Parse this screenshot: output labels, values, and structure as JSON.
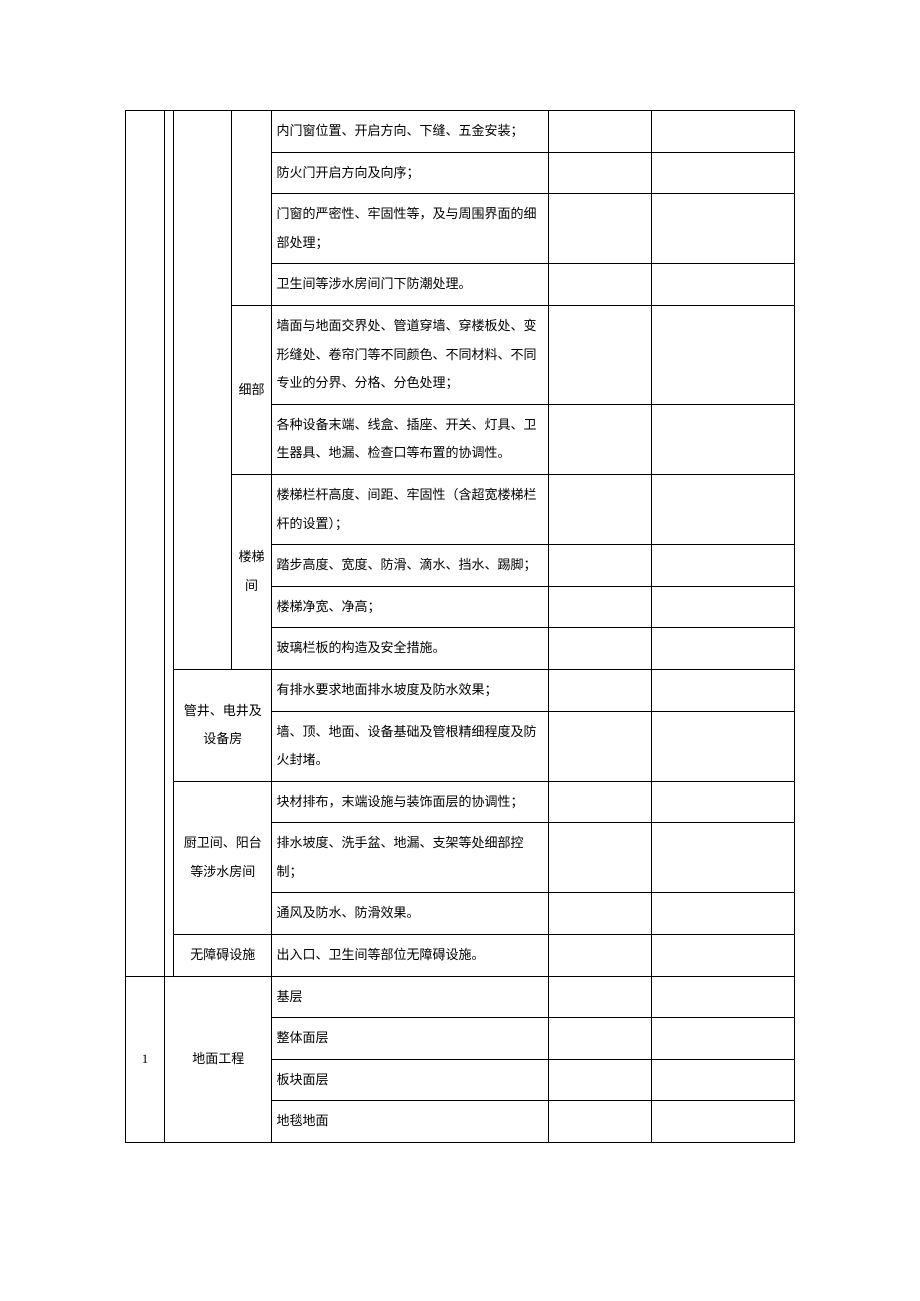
{
  "rows": {
    "r1": "内门窗位置、开启方向、下缝、五金安装；",
    "r2": "防火门开启方向及向序；",
    "r3": "门窗的严密性、牢固性等，及与周围界面的细部处理；",
    "r4": "卫生间等涉水房间门下防潮处理。",
    "r5": "墙面与地面交界处、管道穿墙、穿楼板处、变形缝处、卷帘门等不同颜色、不同材料、不同专业的分界、分格、分色处理；",
    "r6": "各种设备末端、线盒、插座、开关、灯具、卫生器具、地漏、检查口等布置的协调性。",
    "r7": "楼梯栏杆高度、间距、牢固性（含超宽楼梯栏杆的设置）；",
    "r8": "踏步高度、宽度、防滑、滴水、挡水、踢脚；",
    "r9": "楼梯净宽、净高；",
    "r10": "玻璃栏板的构造及安全措施。",
    "r11": "有排水要求地面排水坡度及防水效果；",
    "r12": "墙、顶、地面、设备基础及管根精细程度及防火封堵。",
    "r13": "块材排布，末端设施与装饰面层的协调性；",
    "r14": "排水坡度、洗手盆、地漏、支架等处细部控制；",
    "r15": "通风及防水、防滑效果。",
    "r16": "出入口、卫生间等部位无障碍设施。",
    "r17": "基层",
    "r18": "整体面层",
    "r19": "板块面层",
    "r20": "地毯地面"
  },
  "labels": {
    "xibu": "细部",
    "loutijian": "楼梯间",
    "guanjing": "管井、电井及设备房",
    "chuwei": "厨卫间、阳台等涉水房间",
    "wuzhangai": "无障碍设施",
    "dimian": "地面工程",
    "num1": "1"
  }
}
